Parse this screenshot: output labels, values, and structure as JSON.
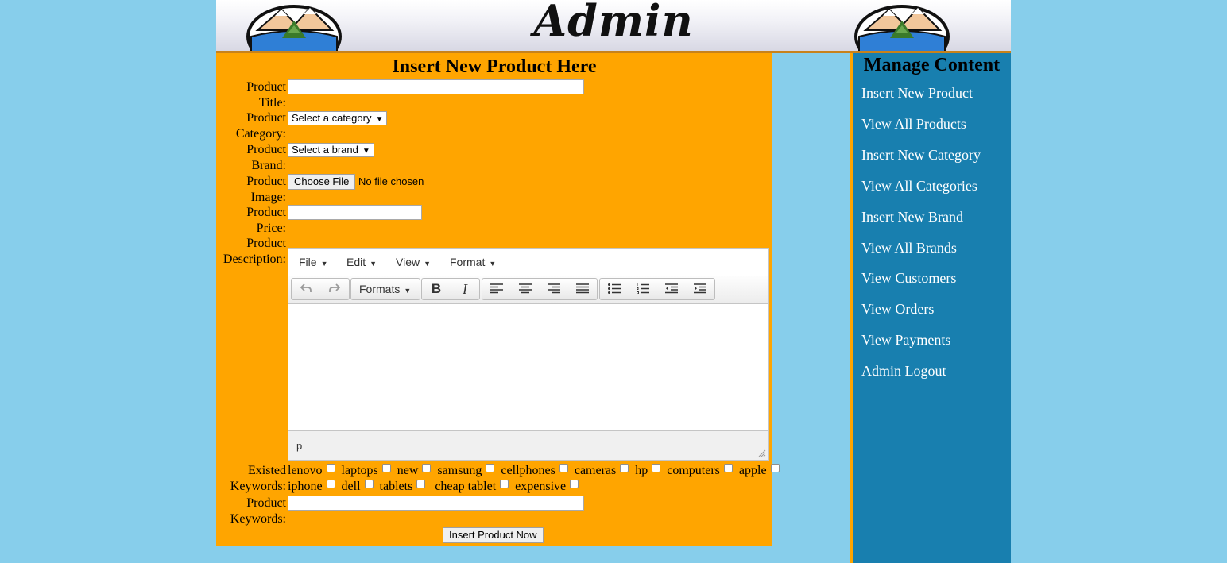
{
  "header": {
    "title": "Admin"
  },
  "form": {
    "heading": "Insert New Product Here",
    "labels": {
      "title": [
        "Product",
        "Title:"
      ],
      "category": [
        "Product",
        "Category:"
      ],
      "brand": [
        "Product",
        "Brand:"
      ],
      "image": [
        "Product",
        "Image:"
      ],
      "price": [
        "Product",
        "Price:"
      ],
      "description": [
        "Product",
        "Description:"
      ],
      "existed_keywords": [
        "Existed",
        "Keywords:"
      ],
      "keywords": [
        "Product",
        "Keywords:"
      ]
    },
    "category_select": "Select a category",
    "brand_select": "Select a brand",
    "file_button": "Choose File",
    "file_status": "No file chosen",
    "title_value": "",
    "price_value": "",
    "keywords_value": "",
    "submit": "Insert Product Now"
  },
  "editor": {
    "menus": [
      "File",
      "Edit",
      "View",
      "Format"
    ],
    "formats_label": "Formats",
    "bold": "B",
    "italic": "I",
    "path": "p"
  },
  "keywords": {
    "row1": [
      "lenovo",
      "laptops",
      "new",
      "samsung",
      "cellphones",
      "cameras",
      "hp",
      "computers",
      "apple"
    ],
    "row2": [
      "iphone",
      "dell",
      "tablets",
      " cheap tablet",
      "expensive"
    ]
  },
  "sidebar": {
    "title": "Manage Content",
    "links": [
      "Insert New Product",
      "View All Products",
      "Insert New Category",
      "View All Categories",
      "Insert New Brand",
      "View All Brands",
      "View Customers",
      "View Orders",
      "View Payments",
      "Admin Logout"
    ]
  }
}
